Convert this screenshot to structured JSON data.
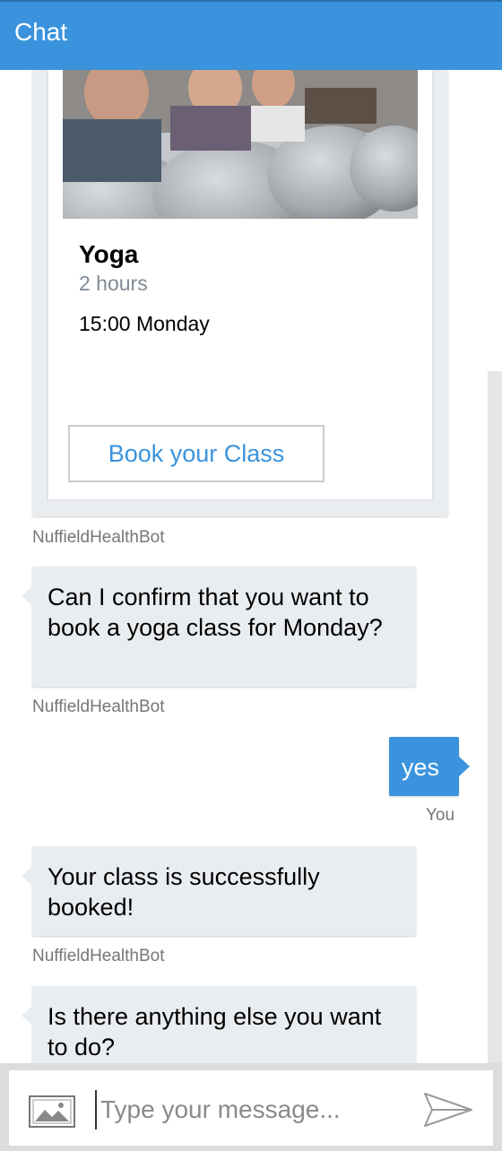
{
  "header": {
    "title": "Chat"
  },
  "card": {
    "title": "Yoga",
    "subtitle": "2 hours",
    "text": "15:00 Monday",
    "button_label": "Book your Class",
    "sender": "NuffieldHealthBot"
  },
  "messages": [
    {
      "text": "Can I confirm that you want to book a yoga class for Monday?",
      "sender": "NuffieldHealthBot"
    },
    {
      "text": "yes",
      "sender": "You"
    },
    {
      "text": "Your class is successfully booked!",
      "sender": "NuffieldHealthBot"
    },
    {
      "text": "Is there anything else you want to do?"
    }
  ],
  "input": {
    "placeholder": "Type your message..."
  },
  "icons": {
    "upload": "image-icon",
    "send": "send-icon"
  },
  "colors": {
    "accent": "#3a93dc",
    "bot_bubble": "#eaedf0",
    "user_bubble": "#3a93dc"
  }
}
